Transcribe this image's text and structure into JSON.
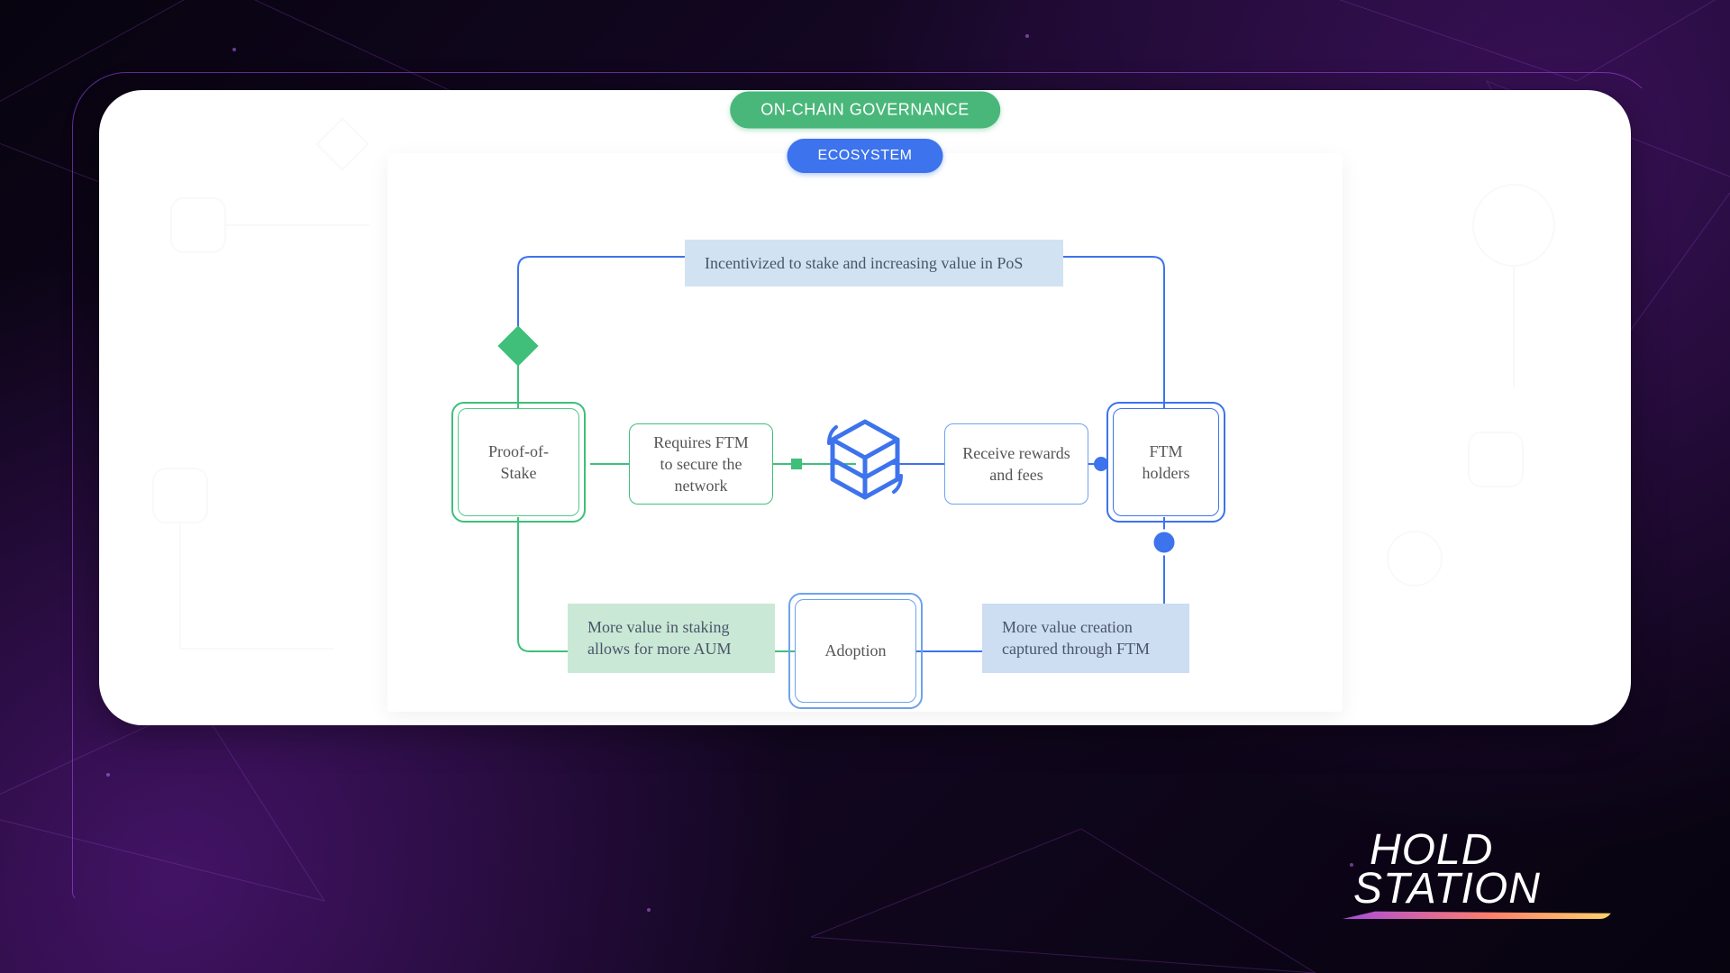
{
  "branding": {
    "logo_line1": "HOLD",
    "logo_line2": "STATION"
  },
  "pills": {
    "governance": "ON-CHAIN GOVERNANCE",
    "ecosystem": "ECOSYSTEM"
  },
  "nodes": {
    "pos": "Proof-of-Stake",
    "requires": "Requires FTM to secure the network",
    "rewards": "Receive rewards and fees",
    "holders": "FTM holders",
    "adoption": "Adoption"
  },
  "tags": {
    "top": "Incentivized to stake and increasing value in PoS",
    "bottom_left": "More value in staking allows for more AUM",
    "bottom_right": "More value creation captured through FTM"
  },
  "icon": {
    "name": "fantom-cube"
  }
}
